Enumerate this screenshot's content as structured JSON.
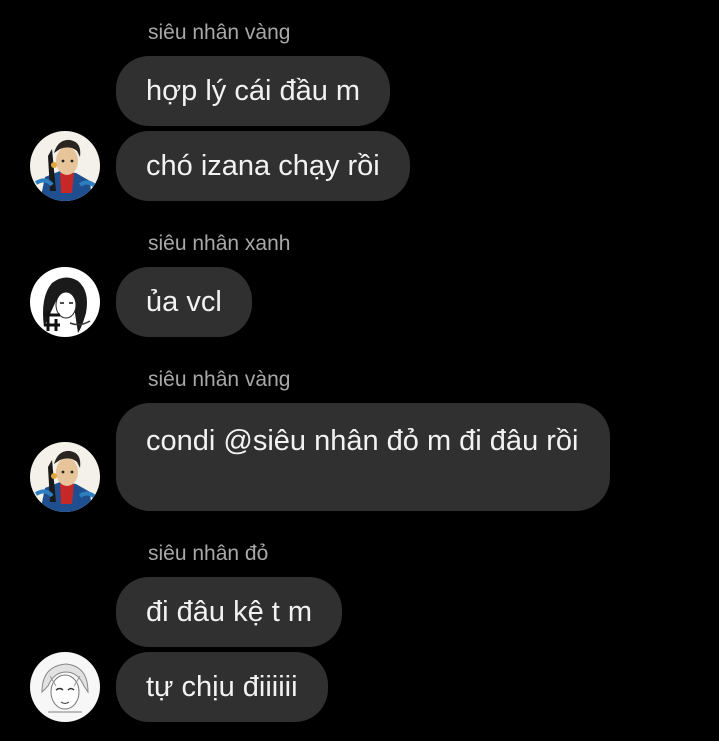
{
  "messages": [
    {
      "sender": "siêu nhân vàng",
      "texts": [
        "hợp lý cái đầu m",
        "chó izana chạy rồi"
      ],
      "avatar": "izana-avatar-icon"
    },
    {
      "sender": "siêu nhân xanh",
      "texts": [
        "ủa vcl"
      ],
      "avatar": "mikey-avatar-icon"
    },
    {
      "sender": "siêu nhân vàng",
      "texts": [
        "condi @siêu nhân đỏ m đi đâu rồi"
      ],
      "avatar": "izana-avatar-icon"
    },
    {
      "sender": "siêu nhân đỏ",
      "texts": [
        "đi đâu kệ t m",
        "tự chịu điiiiii"
      ],
      "avatar": "draken-avatar-icon"
    }
  ]
}
